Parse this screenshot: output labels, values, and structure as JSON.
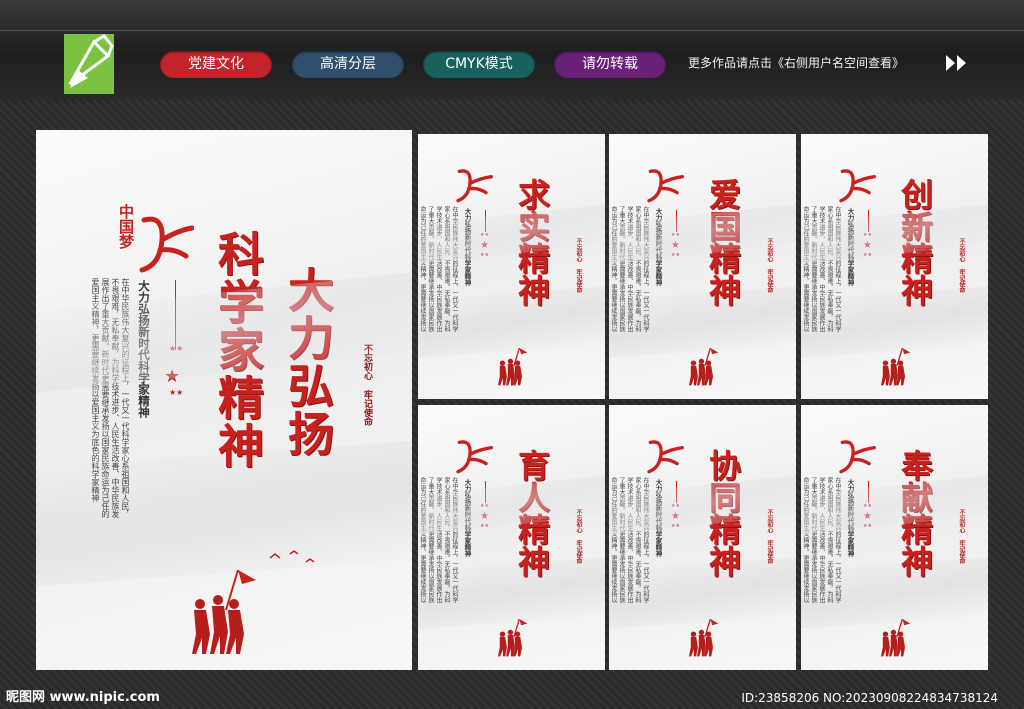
{
  "header": {
    "tags": [
      {
        "label": "党建文化",
        "color": "#c4242b"
      },
      {
        "label": "高清分层",
        "color": "#2e4f6d"
      },
      {
        "label": "CMYK模式",
        "color": "#19615e"
      },
      {
        "label": "请勿转载",
        "color": "#6a2178"
      }
    ],
    "note": "更多作品请点击《右侧用户名空间查看》"
  },
  "main_panel": {
    "brand": "中国梦",
    "title_line1": "大力弘扬",
    "title_line2": "科学家精神",
    "subtitle": "大力弘扬新时代科学家精神",
    "body": "在中华民族伟大复兴的征程上，一代又一代科学家心系祖国和人民，不畏艰难，无私奉献，为科学技术进步、人民生活改善、中华民族发展作出了重大贡献。新时代更需要继承发扬以国家民族命运为己任的爱国主义精神，更需要继续发扬以爱国主义为底色的科学家精神",
    "motto": "不忘初心 牢记使命"
  },
  "panels": [
    {
      "title": "求实精神"
    },
    {
      "title": "爱国精神"
    },
    {
      "title": "创新精神"
    },
    {
      "title": "育人精神"
    },
    {
      "title": "协同精神"
    },
    {
      "title": "奉献精神"
    }
  ],
  "small_subtitle": "大力弘扬新时代科学家精神",
  "small_motto": "不忘初心 牢记使命",
  "footer": {
    "site": "昵图网 www.nipic.com",
    "id": "ID:23858206 NO:20230908224834738124"
  },
  "colors": {
    "accent": "#c8221e"
  }
}
